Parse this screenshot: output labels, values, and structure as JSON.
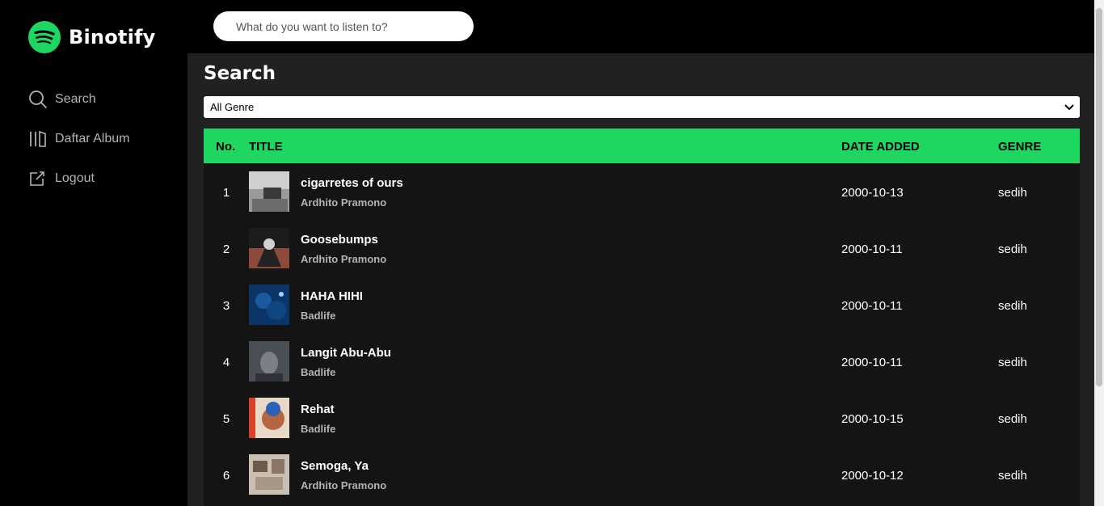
{
  "app": {
    "name": "Binotify",
    "accent": "#1ed760"
  },
  "search": {
    "placeholder": "What do you want to listen to?"
  },
  "nav": [
    {
      "label": "Search",
      "icon": "search-icon"
    },
    {
      "label": "Daftar Album",
      "icon": "library-icon"
    },
    {
      "label": "Logout",
      "icon": "external-link-icon"
    }
  ],
  "page": {
    "title": "Search"
  },
  "filter": {
    "selected": "All Genre"
  },
  "table": {
    "headers": {
      "no": "No.",
      "title": "TITLE",
      "date": "DATE ADDED",
      "genre": "GENRE"
    },
    "rows": [
      {
        "no": "1",
        "title": "cigarretes of ours",
        "artist": "Ardhito Pramono",
        "date": "2000-10-13",
        "genre": "sedih",
        "cover": "#7a7a7a"
      },
      {
        "no": "2",
        "title": "Goosebumps",
        "artist": "Ardhito Pramono",
        "date": "2000-10-11",
        "genre": "sedih",
        "cover": "#6b3b2e"
      },
      {
        "no": "3",
        "title": "HAHA HIHI",
        "artist": "Badlife",
        "date": "2000-10-11",
        "genre": "sedih",
        "cover": "#0d3a6e"
      },
      {
        "no": "4",
        "title": "Langit Abu-Abu",
        "artist": "Badlife",
        "date": "2000-10-11",
        "genre": "sedih",
        "cover": "#5a5f66"
      },
      {
        "no": "5",
        "title": "Rehat",
        "artist": "Badlife",
        "date": "2000-10-15",
        "genre": "sedih",
        "cover": "#c0503a"
      },
      {
        "no": "6",
        "title": "Semoga, Ya",
        "artist": "Ardhito Pramono",
        "date": "2000-10-12",
        "genre": "sedih",
        "cover": "#8b7a6a"
      }
    ]
  }
}
